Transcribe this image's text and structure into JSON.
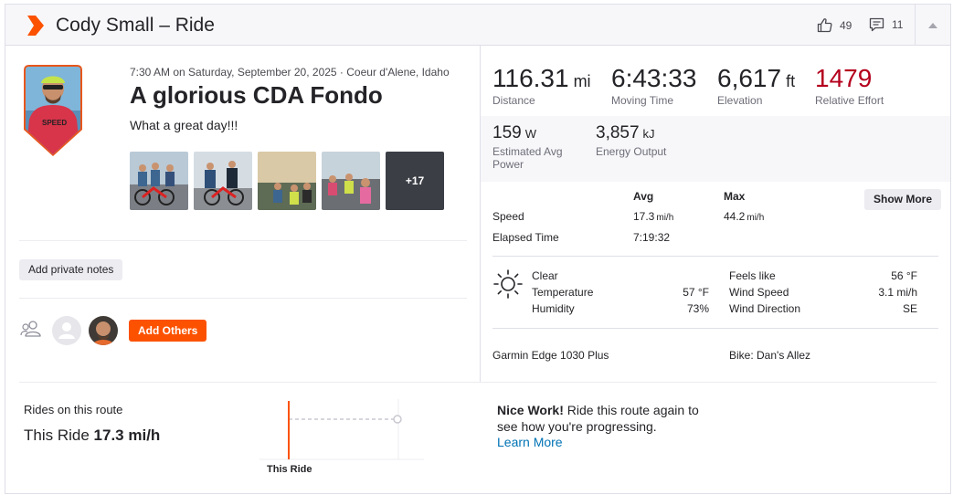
{
  "header": {
    "title": "Cody Small – Ride",
    "kudos_count": "49",
    "comments_count": "11"
  },
  "activity": {
    "meta": "7:30 AM on Saturday, September 20, 2025 · Coeur d'Alene, Idaho",
    "name": "A glorious CDA Fondo",
    "description": "What a great day!!!",
    "photos_more": "+17"
  },
  "buttons": {
    "private_notes": "Add private notes",
    "add_others": "Add Others",
    "show_more": "Show More"
  },
  "stats": {
    "distance": {
      "value": "116.31",
      "unit": "mi",
      "label": "Distance"
    },
    "moving_time": {
      "value": "6:43:33",
      "label": "Moving Time"
    },
    "elevation": {
      "value": "6,617",
      "unit": "ft",
      "label": "Elevation"
    },
    "relative_effort": {
      "value": "1479",
      "label": "Relative Effort"
    },
    "avg_power": {
      "value": "159",
      "unit": "W",
      "label": "Estimated Avg Power"
    },
    "energy": {
      "value": "3,857",
      "unit": "kJ",
      "label": "Energy Output"
    }
  },
  "more_stats": {
    "col_avg": "Avg",
    "col_max": "Max",
    "speed_label": "Speed",
    "speed_avg": "17.3",
    "speed_avg_unit": "mi/h",
    "speed_max": "44.2",
    "speed_max_unit": "mi/h",
    "elapsed_label": "Elapsed Time",
    "elapsed_avg": "7:19:32"
  },
  "weather": {
    "condition": "Clear",
    "temperature_label": "Temperature",
    "temperature": "57 °F",
    "humidity_label": "Humidity",
    "humidity": "73%",
    "feels_like_label": "Feels like",
    "feels_like": "56 °F",
    "wind_speed_label": "Wind Speed",
    "wind_speed": "3.1 mi/h",
    "wind_dir_label": "Wind Direction",
    "wind_dir": "SE"
  },
  "gear": {
    "device": "Garmin Edge 1030 Plus",
    "bike": "Bike: Dan's Allez"
  },
  "route": {
    "label": "Rides on this route",
    "this_ride_prefix": "This Ride",
    "this_ride_value": "17.3 mi/h",
    "chart_label": "This Ride",
    "nice_bold": "Nice Work!",
    "nice_text": " Ride this route again to see how you're progressing.",
    "learn_more": "Learn More"
  },
  "colors": {
    "brand": "#fc5200",
    "effort": "#b4001d",
    "link": "#0073b5"
  }
}
